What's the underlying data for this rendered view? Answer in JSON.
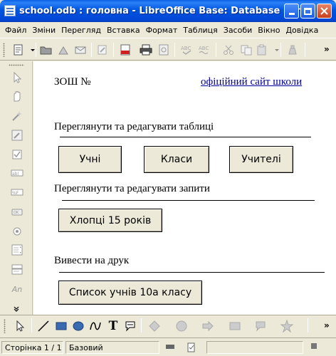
{
  "window": {
    "title": "school.odb : головна - LibreOffice Base: Database Form"
  },
  "menu": {
    "items": [
      "Файл",
      "Зміни",
      "Перегляд",
      "Вставка",
      "Формат",
      "Таблиця",
      "Засоби",
      "Вікно",
      "Довідка"
    ]
  },
  "toolbar": {
    "icons": [
      "edit-file-icon",
      "dropdown-icon",
      "open-icon",
      "save-icon",
      "email-icon",
      "edit-mode-icon",
      "export-pdf-icon",
      "print-icon",
      "print-preview-icon",
      "spellcheck-icon",
      "autospell-icon",
      "cut-icon",
      "copy-icon",
      "paste-icon",
      "clone-icon"
    ],
    "more": "»"
  },
  "left_toolbar": {
    "icons": [
      "select-icon",
      "design-mode-icon",
      "control-wizard-icon",
      "form-design-icon",
      "checkbox-icon",
      "text-box-icon",
      "formatted-field-icon",
      "push-button-icon",
      "option-button-icon",
      "list-box-icon",
      "combo-box-icon",
      "label-field-icon"
    ],
    "label_field_text": "An",
    "more": "»"
  },
  "form": {
    "school_label": "ЗОШ №",
    "site_link": "офіційний сайт школи",
    "section_tables": "Переглянути та редагувати таблиці",
    "section_queries": "Переглянути та редагувати запити",
    "section_print": "Вивести на друк",
    "buttons": {
      "students": "Учні",
      "classes": "Класи",
      "teachers": "Учителі",
      "boys_15": "Хлопці 15 років",
      "student_list": "Список учнів 10а класу"
    }
  },
  "drawing_toolbar": {
    "icons": [
      "select-icon",
      "line-icon",
      "rectangle-icon",
      "ellipse-icon",
      "curve-icon",
      "text-icon",
      "callout-icon",
      "basic-shapes-icon",
      "symbol-shapes-icon",
      "block-arrows-icon",
      "flowchart-icon",
      "callouts-icon",
      "stars-icon"
    ],
    "text_glyph": "T"
  },
  "status": {
    "page": "Сторінка 1 / 1",
    "style": "Базовий"
  }
}
